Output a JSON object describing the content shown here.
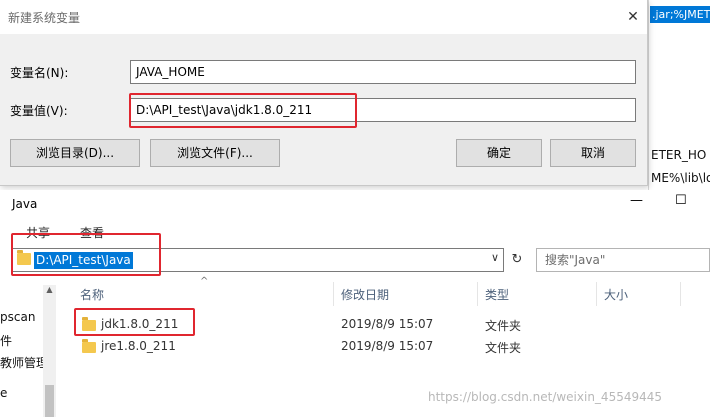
{
  "back_window": {
    "selected_text": ".jar;%JMETE",
    "line1": "ETER_HO",
    "line2": "ME%\\lib\\lo"
  },
  "dialog": {
    "title": "新建系统变量",
    "close_glyph": "✕",
    "name_label": "变量名(N):",
    "name_value": "JAVA_HOME",
    "value_label": "变量值(V):",
    "value_value": "D:\\API_test\\Java\\jdk1.8.0_211",
    "browse_dir_label": "浏览目录(D)...",
    "browse_file_label": "浏览文件(F)...",
    "ok_label": "确定",
    "cancel_label": "取消"
  },
  "explorer": {
    "title": "Java",
    "minimize_glyph": "—",
    "maximize_glyph": "☐",
    "tab_share": "共享",
    "tab_view": "查看",
    "address_path": "D:\\API_test\\Java",
    "address_chevron": "∨",
    "refresh_glyph": "↻",
    "search_placeholder": "搜索\"Java\"",
    "nav_items": [
      "pscan",
      "件",
      "教师管理",
      "e"
    ],
    "nav_scroll_up": "▲",
    "sort_arrow": "^",
    "columns": [
      "名称",
      "修改日期",
      "类型",
      "大小"
    ],
    "rows": [
      {
        "name": "jdk1.8.0_211",
        "modified": "2019/8/9 15:07",
        "type": "文件夹"
      },
      {
        "name": "jre1.8.0_211",
        "modified": "2019/8/9 15:07",
        "type": "文件夹"
      }
    ]
  },
  "watermark": "https://blog.csdn.net/weixin_45549445",
  "icons": {
    "folder": "folder-icon"
  },
  "colors": {
    "highlight_red": "#e0262f",
    "selection_blue": "#0078d7",
    "folder_yellow": "#f4c84e"
  }
}
